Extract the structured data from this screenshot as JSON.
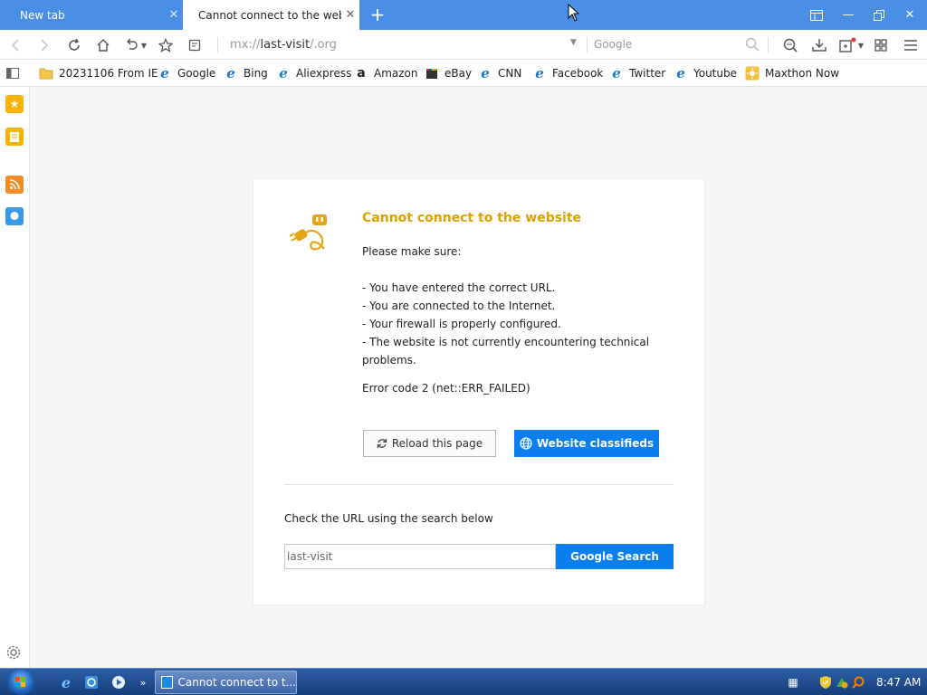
{
  "tabs": [
    {
      "title": "New tab",
      "active": false
    },
    {
      "title": "Cannot connect to the websit",
      "active": true
    }
  ],
  "toolbar": {
    "url_prefix": "mx://",
    "url_main": "last-visit",
    "url_suffix": "/.org",
    "search_placeholder": "Google"
  },
  "bookmarks": [
    {
      "label": "20231106 From IE",
      "icon": "folder-icon"
    },
    {
      "label": "Google",
      "icon": "ie-icon"
    },
    {
      "label": "Bing",
      "icon": "ie-icon"
    },
    {
      "label": "Aliexpress",
      "icon": "ie-icon"
    },
    {
      "label": "Amazon",
      "icon": "amazon-icon"
    },
    {
      "label": "eBay",
      "icon": "ebay-icon"
    },
    {
      "label": "CNN",
      "icon": "ie-icon"
    },
    {
      "label": "Facebook",
      "icon": "ie-icon"
    },
    {
      "label": "Twitter",
      "icon": "ie-icon"
    },
    {
      "label": "Youtube",
      "icon": "ie-icon"
    },
    {
      "label": "Maxthon Now",
      "icon": "maxthon-now-icon"
    }
  ],
  "error": {
    "title": "Cannot connect to the website",
    "intro": "Please make sure:",
    "items": [
      "- You have entered the correct URL.",
      "- You are connected to the Internet.",
      "- Your firewall is properly configured.",
      "- The website is not currently encountering technical problems."
    ],
    "code": "Error code 2 (net::ERR_FAILED)",
    "reload_label": "Reload this page",
    "classified_label": "Website classifieds",
    "check_label": "Check the URL using the search below",
    "search_value": "last-visit",
    "google_button": "Google Search"
  },
  "taskbar": {
    "task_label": "Cannot connect to t...",
    "clock": "8:47 AM"
  },
  "colors": {
    "tabbar": "#4a8ee6",
    "error_title": "#e0a000",
    "primary_button": "#0b7ff0"
  }
}
